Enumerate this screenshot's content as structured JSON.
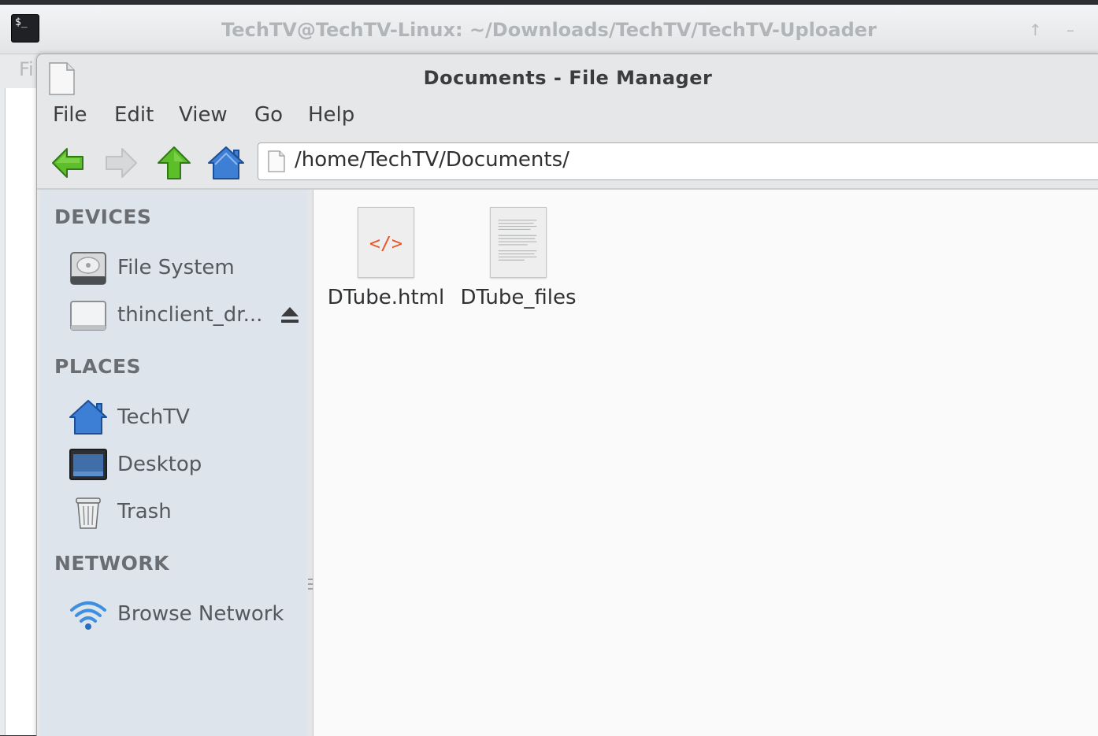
{
  "terminal": {
    "title": "TechTV@TechTV-Linux: ~/Downloads/TechTV/TechTV-Uploader",
    "icon": "terminal-icon",
    "icon_text": "$_",
    "menu_peek": "Fi"
  },
  "file_manager": {
    "title": "Documents - File Manager",
    "menu": [
      "File",
      "Edit",
      "View",
      "Go",
      "Help"
    ],
    "toolbar": {
      "back_icon": "back-arrow-icon",
      "forward_icon": "forward-arrow-icon",
      "up_icon": "up-arrow-icon",
      "home_icon": "home-icon"
    },
    "location": "/home/TechTV/Documents/",
    "sidebar": {
      "devices_heading": "DEVICES",
      "devices": [
        {
          "label": "File System",
          "icon": "hard-drive-icon"
        },
        {
          "label": "thinclient_dr...",
          "icon": "removable-drive-icon",
          "eject": true
        }
      ],
      "places_heading": "PLACES",
      "places": [
        {
          "label": "TechTV",
          "icon": "home-folder-icon"
        },
        {
          "label": "Desktop",
          "icon": "desktop-icon"
        },
        {
          "label": "Trash",
          "icon": "trash-icon"
        }
      ],
      "network_heading": "NETWORK",
      "network": [
        {
          "label": "Browse Network",
          "icon": "network-wifi-icon"
        }
      ]
    },
    "files": [
      {
        "name": "DTube.html",
        "icon": "html-file-icon",
        "glyph": "</>"
      },
      {
        "name": "DTube_files",
        "icon": "text-document-icon"
      }
    ],
    "colors": {
      "accent_green": "#4caf1f",
      "accent_blue": "#3e7fd6",
      "html_glyph": "#e8562a"
    }
  }
}
